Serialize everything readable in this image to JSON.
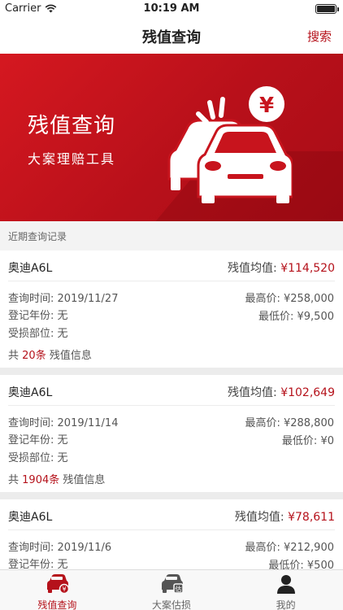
{
  "status_bar": {
    "carrier": "Carrier",
    "time": "10:19 AM"
  },
  "nav": {
    "title": "残值查询",
    "action": "搜索"
  },
  "banner": {
    "title": "残值查询",
    "subtitle": "大案理赔工具",
    "badge": "¥"
  },
  "section": {
    "title": "近期查询记录"
  },
  "labels": {
    "avg": "残值均值:",
    "query_time": "查询时间:",
    "reg_year": "登记年份:",
    "damage": "受损部位:",
    "max": "最高价:",
    "min": "最低价:",
    "total_prefix": "共",
    "total_suffix": "残值信息"
  },
  "records": [
    {
      "model": "奥迪A6L",
      "avg": "¥114,520",
      "query_time": "2019/11/27",
      "reg_year": "无",
      "damage": "无",
      "max": "¥258,000",
      "min": "¥9,500",
      "count": "20条"
    },
    {
      "model": "奥迪A6L",
      "avg": "¥102,649",
      "query_time": "2019/11/14",
      "reg_year": "无",
      "damage": "无",
      "max": "¥288,800",
      "min": "¥0",
      "count": "1904条"
    },
    {
      "model": "奥迪A6L",
      "avg": "¥78,611",
      "query_time": "2019/11/6",
      "reg_year": "无",
      "damage": "",
      "max": "¥212,900",
      "min": "¥500",
      "count": ""
    }
  ],
  "tabs": [
    {
      "label": "残值查询",
      "icon": "car-badge-icon",
      "active": true
    },
    {
      "label": "大案估损",
      "icon": "car-estimate-icon",
      "active": false
    },
    {
      "label": "我的",
      "icon": "person-icon",
      "active": false
    }
  ],
  "colors": {
    "accent": "#b5121b",
    "banner": "#c8141d"
  }
}
